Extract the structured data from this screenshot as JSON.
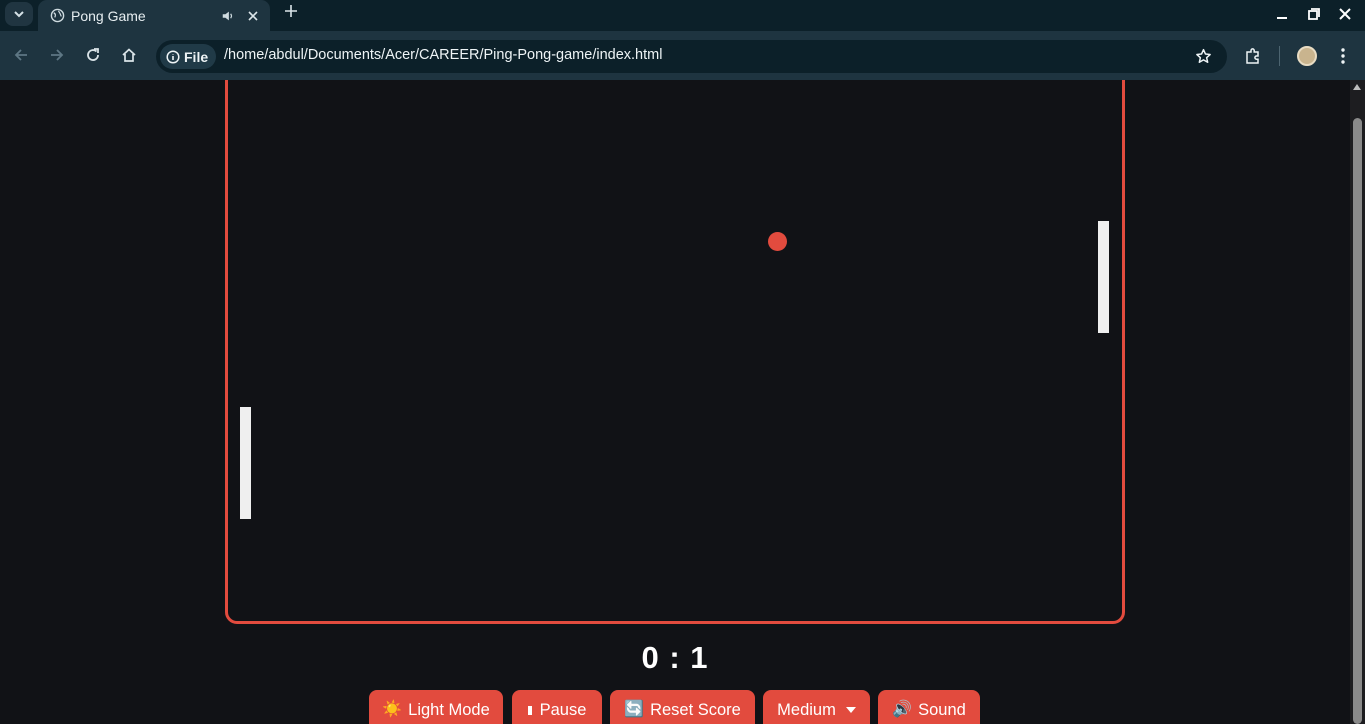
{
  "browser": {
    "tab": {
      "title": "Pong Game"
    },
    "url_chip": "File",
    "url": "/home/abdul/Documents/Acer/CAREER/Ping-Pong-game/index.html"
  },
  "game": {
    "score": {
      "left": 0,
      "right": 1,
      "display": "0 : 1"
    },
    "colors": {
      "accent": "#e24b3e",
      "paddle": "#efefef",
      "background": "#111216"
    }
  },
  "controls": {
    "theme_label": "Light Mode",
    "theme_icon": "☀️",
    "pause_label": "Pause",
    "reset_label": "Reset Score",
    "reset_icon": "🔄",
    "difficulty_label": "Medium",
    "sound_label": "Sound",
    "sound_icon": "🔊"
  }
}
